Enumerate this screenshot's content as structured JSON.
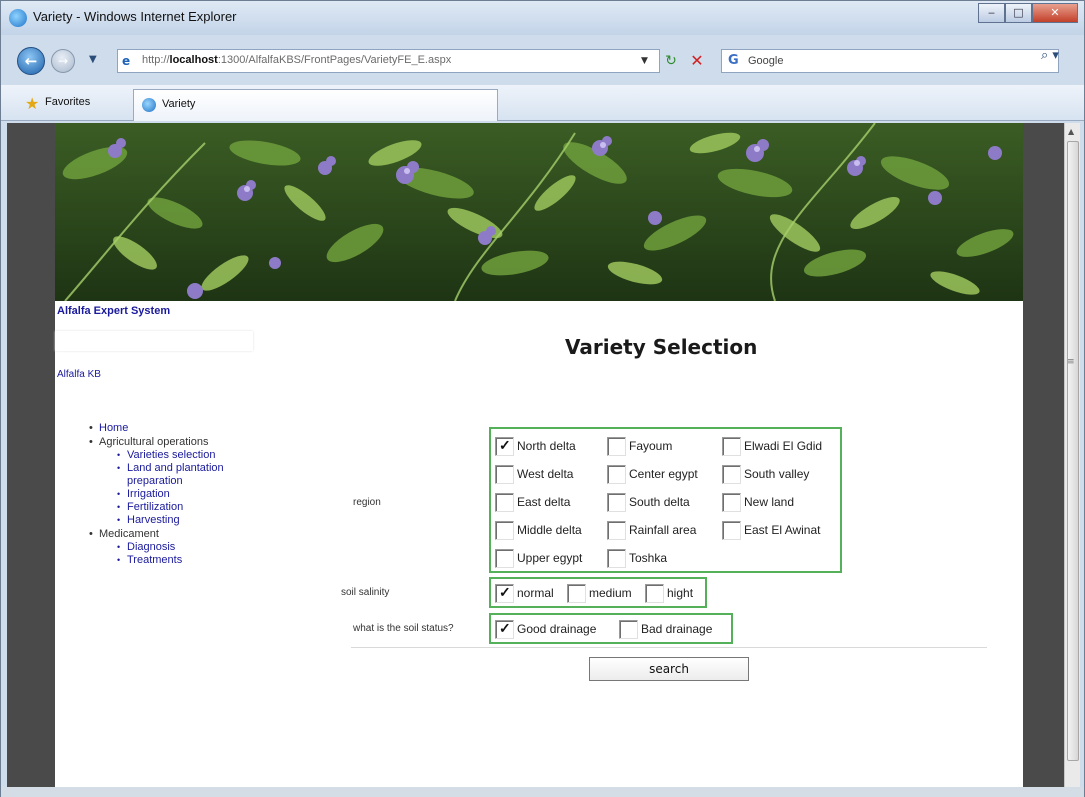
{
  "browser": {
    "window_title": "Variety - Windows Internet Explorer",
    "url_prefix": "http://",
    "url_host": "localhost",
    "url_rest": ":1300/AlfalfaKBS/FrontPages/VarietyFE_E.aspx",
    "search_placeholder": "Google",
    "favorites_label": "Favorites",
    "tab_label": "Variety"
  },
  "site": {
    "title": "Alfalfa Expert System",
    "kb_link": "Alfalfa KB"
  },
  "nav": {
    "home": "Home",
    "agri_ops": "Agricultural operations",
    "varieties": "Varieties selection",
    "land_1": "Land and plantation",
    "land_2": "preparation",
    "irrigation": "Irrigation",
    "fertilization": "Fertilization",
    "harvesting": "Harvesting",
    "medicament": "Medicament",
    "diagnosis": "Diagnosis",
    "treatments": "Treatments"
  },
  "form": {
    "heading": "Variety Selection",
    "region_label": "region",
    "salinity_label": "soil salinity",
    "soil_status_label": "what is the soil status?",
    "region_options": [
      {
        "label": "North delta",
        "checked": true
      },
      {
        "label": "Fayoum",
        "checked": false
      },
      {
        "label": "Elwadi El Gdid",
        "checked": false
      },
      {
        "label": "West delta",
        "checked": false
      },
      {
        "label": "Center egypt",
        "checked": false
      },
      {
        "label": "South valley",
        "checked": false
      },
      {
        "label": "East delta",
        "checked": false
      },
      {
        "label": "South delta",
        "checked": false
      },
      {
        "label": "New land",
        "checked": false
      },
      {
        "label": "Middle delta",
        "checked": false
      },
      {
        "label": "Rainfall area",
        "checked": false
      },
      {
        "label": "East El Awinat",
        "checked": false
      },
      {
        "label": "Upper egypt",
        "checked": false
      },
      {
        "label": "Toshka",
        "checked": false
      }
    ],
    "salinity_options": [
      {
        "label": "normal",
        "checked": true
      },
      {
        "label": "medium",
        "checked": false
      },
      {
        "label": "hight",
        "checked": false
      }
    ],
    "soil_status_options": [
      {
        "label": "Good drainage",
        "checked": true
      },
      {
        "label": "Bad drainage",
        "checked": false
      }
    ],
    "search_button": "search"
  },
  "colors": {
    "group_border": "#55b05a",
    "link": "#1a1a9c"
  }
}
